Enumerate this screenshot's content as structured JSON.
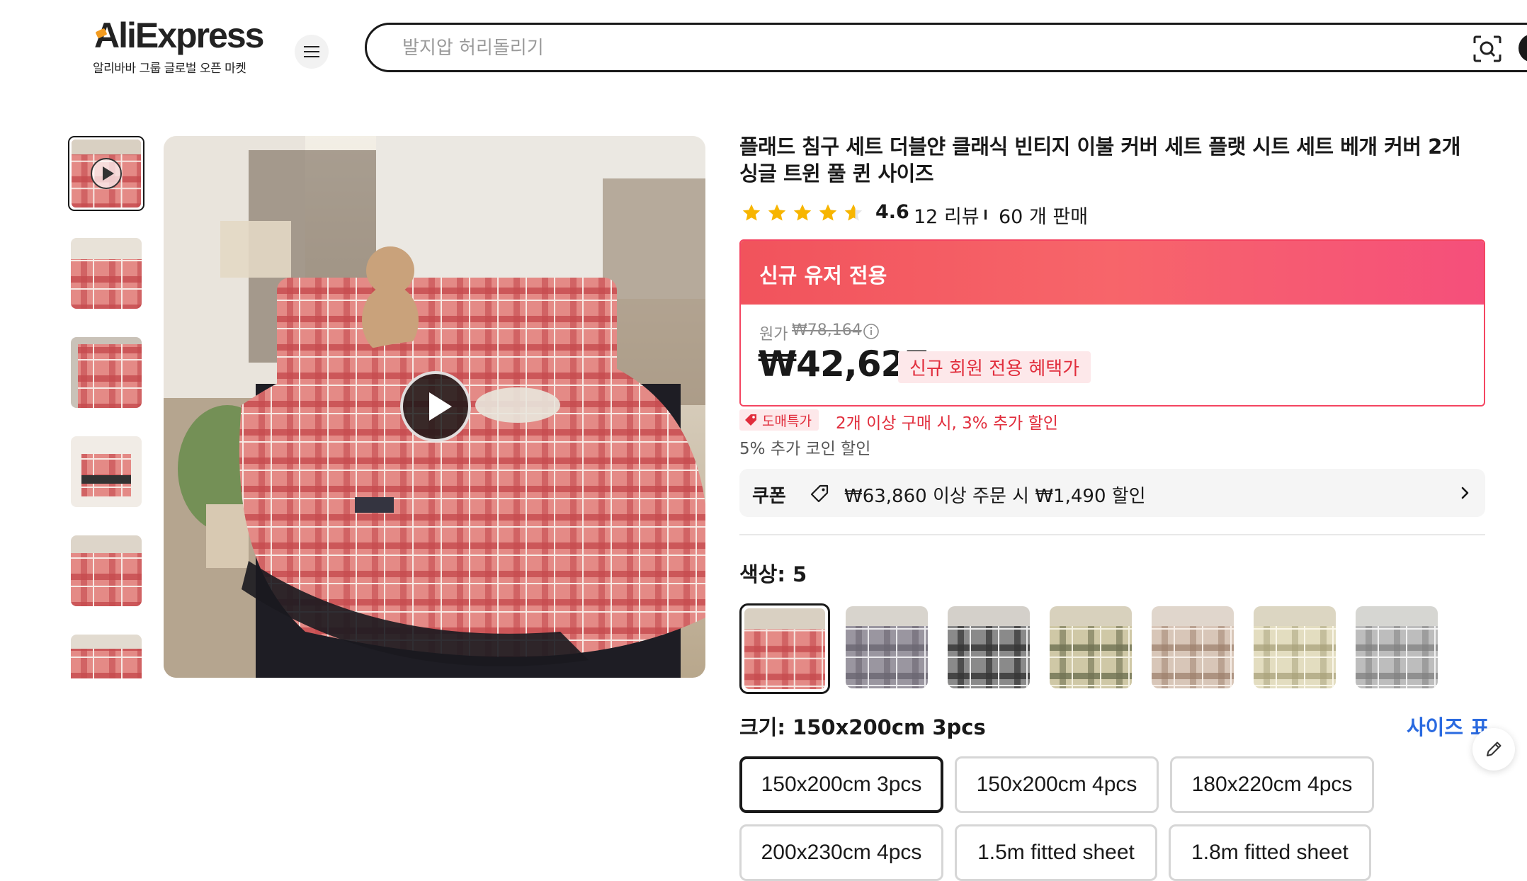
{
  "header": {
    "logo": "AliExpress",
    "logo_tagline": "알리바바 그룹 글로벌 오픈 마켓",
    "search_placeholder": "발지압 허리돌리기"
  },
  "product": {
    "title": "플래드 침구 세트 더블얀 클래식 빈티지 이불 커버 세트 플랫 시트 세트 베개 커버 2개 싱글 트윈 풀 퀸 사이즈",
    "rating": "4.6",
    "rating_value": 4.6,
    "reviews": "12 리뷰",
    "sold": "60 개 판매",
    "promo_banner": "신규 유저 전용",
    "original_label": "원가",
    "original_price": "₩78,164",
    "price": "₩42,627",
    "member_tag": "신규 회원 전용 혜택가",
    "deal_tag": "도매특가",
    "deal_text": "2개 이상 구매 시, 3% 추가 할인",
    "coin_text": "5% 추가 코인 할인",
    "coupon_label": "쿠폰",
    "coupon_text": "₩63,860 이상 주문 시 ₩1,490 할인",
    "color_label": "색상: 5",
    "size_label": "크기: 150x200cm 3pcs",
    "size_chart": "사이즈 표",
    "sizes": [
      "150x200cm 3pcs",
      "150x200cm 4pcs",
      "180x220cm 4pcs",
      "200x230cm 4pcs",
      "1.5m fitted sheet",
      "1.8m fitted sheet"
    ]
  },
  "colors": {
    "accent_red": "#e12d3c",
    "promo_border": "#f44561",
    "link_blue": "#2a6ae0",
    "star": "#f7b500"
  }
}
